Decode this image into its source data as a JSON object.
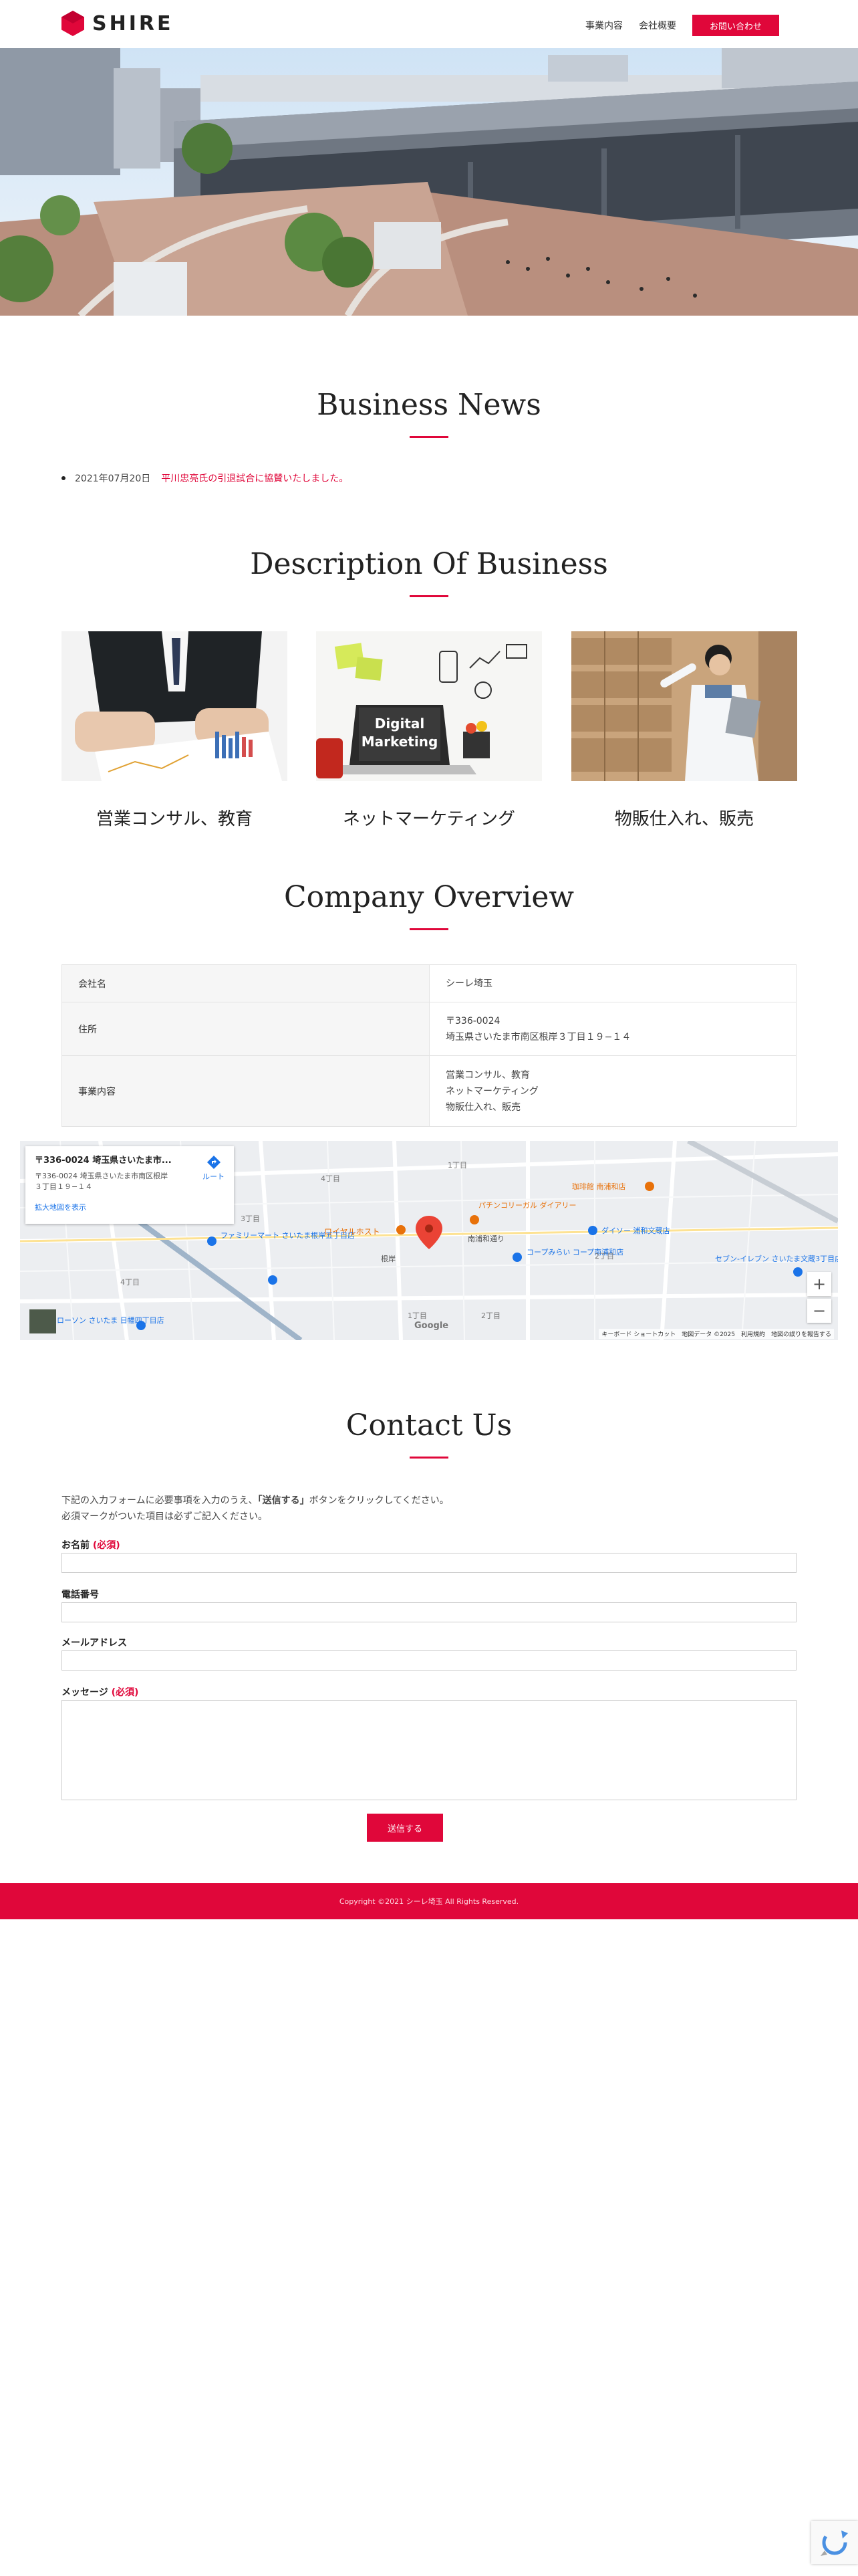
{
  "header": {
    "logo_text": "SHIRE",
    "nav": [
      {
        "label": "事業内容"
      },
      {
        "label": "会社概要"
      }
    ],
    "cta_label": "お問い合わせ"
  },
  "news": {
    "title": "Business News",
    "items": [
      {
        "date": "2021年07月20日",
        "text": "平川忠亮氏の引退試合に協賛いたしました。"
      }
    ]
  },
  "business": {
    "title": "Description Of Business",
    "cards": [
      {
        "title": "営業コンサル、教育"
      },
      {
        "title": "ネットマーケティング",
        "image_text_1": "Digital",
        "image_text_2": "Marketing"
      },
      {
        "title": "物販仕入れ、販売"
      }
    ]
  },
  "company": {
    "title": "Company Overview",
    "rows": [
      {
        "label": "会社名",
        "lines": [
          "シーレ埼玉"
        ]
      },
      {
        "label": "住所",
        "lines": [
          "〒336-0024",
          "埼玉県さいたま市南区根岸３丁目１９−１４"
        ]
      },
      {
        "label": "事業内容",
        "lines": [
          "営業コンサル、教育",
          "ネットマーケティング",
          "物販仕入れ、販売"
        ]
      }
    ]
  },
  "map": {
    "info_title": "〒336-0024 埼玉県さいたま市...",
    "info_address": "〒336-0024 埼玉県さいたま市南区根岸３丁目１９−１４",
    "enlarge_label": "拡大地図を表示",
    "route_label": "ルート",
    "zoom_in": "+",
    "zoom_out": "−",
    "google": "Google",
    "footer": "キーボード ショートカット　地図データ ©2025　利用規約　地図の誤りを報告する",
    "labels": {
      "royal_host": "ロイヤルホスト",
      "familymart": "ファミリーマート さいたま根岸五丁目店",
      "daiso": "ダイソー 浦和文蔵店",
      "coop": "コープみらい コープ南浦和店",
      "lawson": "ローソン さいたま 日幡四丁目店",
      "seven": "セブン-イレブン さいたま文蔵3丁目店",
      "coffee": "珈琲館 南浦和店",
      "minamiura": "南浦和通り",
      "negishi": "根岸",
      "pachinko": "パチンコリーガル ダイアリー",
      "chome4": "4丁目",
      "chome3": "3丁目",
      "chome2": "2丁目",
      "chome1": "1丁目"
    }
  },
  "contact": {
    "title": "Contact Us",
    "intro_1a": "下記の入力フォームに必要事項を入力のうえ、",
    "intro_1b": "「送信する」",
    "intro_1c": "ボタンをクリックしてください。",
    "intro_2": "必須マークがついた項目は必ずご記入ください。",
    "name_label": "お名前",
    "phone_label": "電話番号",
    "email_label": "メールアドレス",
    "message_label": "メッセージ",
    "required_mark": "(必須)",
    "submit_label": "送信する"
  },
  "footer": {
    "copyright": "Copyright ©2021 シーレ埼玉 All Rights Reserved."
  },
  "colors": {
    "accent": "#e0073a"
  }
}
